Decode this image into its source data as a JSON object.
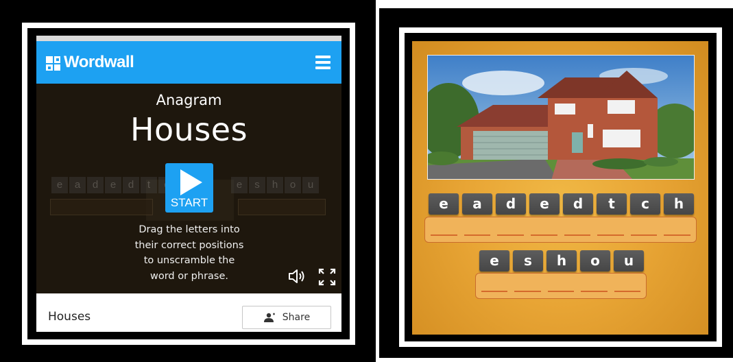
{
  "left_panel": {
    "brand": "Wordwall",
    "activity_type": "Anagram",
    "activity_title": "Houses",
    "start_label": "START",
    "instructions": [
      "Drag the letters into",
      "their correct positions",
      "to unscramble the",
      "word or phrase."
    ],
    "footer_title": "Houses",
    "share_label": "Share",
    "ghost_letters_a": [
      "e",
      "a",
      "d",
      "e",
      "d",
      "t",
      "c",
      "h"
    ],
    "ghost_letters_b": [
      "e",
      "s",
      "h",
      "o",
      "u"
    ],
    "icons": [
      "menu-icon",
      "play-icon",
      "sound-icon",
      "fullscreen-icon",
      "person-icon"
    ],
    "colors": {
      "header": "#1da1f2",
      "background": "#1e170d",
      "start_button": "#1da1f2"
    }
  },
  "right_panel": {
    "image_description": "house-photo",
    "row1_letters": [
      "e",
      "a",
      "d",
      "e",
      "d",
      "t",
      "c",
      "h"
    ],
    "row2_letters": [
      "e",
      "s",
      "h",
      "o",
      "u"
    ],
    "row1_slots": 8,
    "row2_slots": 5,
    "colors": {
      "background": "#e8a535",
      "tile": "#505050",
      "slot_border": "#c96b2c"
    }
  }
}
